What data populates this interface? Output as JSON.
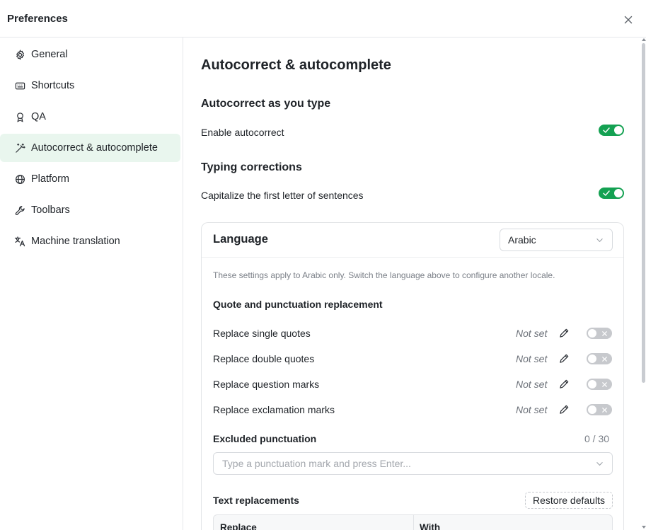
{
  "dialog": {
    "title": "Preferences",
    "close_icon": "close-icon"
  },
  "sidebar": {
    "items": [
      {
        "label": "General",
        "icon": "gear-icon",
        "active": false
      },
      {
        "label": "Shortcuts",
        "icon": "keyboard-icon",
        "active": false
      },
      {
        "label": "QA",
        "icon": "award-icon",
        "active": false
      },
      {
        "label": "Autocorrect & autocomplete",
        "icon": "magic-wand-icon",
        "active": true
      },
      {
        "label": "Platform",
        "icon": "globe-icon",
        "active": false
      },
      {
        "label": "Toolbars",
        "icon": "wrench-icon",
        "active": false
      },
      {
        "label": "Machine translation",
        "icon": "translate-icon",
        "active": false
      }
    ]
  },
  "colors": {
    "accent_green": "#14a152",
    "active_nav_bg": "#e9f6ee",
    "toggle_off": "#c7c9cd"
  },
  "main": {
    "page_title": "Autocorrect & autocomplete",
    "section_autocorrect": {
      "heading": "Autocorrect as you type",
      "enable_label": "Enable autocorrect",
      "enable_on": true
    },
    "section_typing": {
      "heading": "Typing corrections",
      "capitalize_label": "Capitalize the first letter of sentences",
      "capitalize_on": true
    },
    "language": {
      "heading": "Language",
      "selected": "Arabic",
      "note": "These settings apply to Arabic only. Switch the language above to configure another locale.",
      "quote_heading": "Quote and punctuation replacement",
      "replacements": [
        {
          "label": "Replace single quotes",
          "value": "Not set",
          "on": false
        },
        {
          "label": "Replace double quotes",
          "value": "Not set",
          "on": false
        },
        {
          "label": "Replace question marks",
          "value": "Not set",
          "on": false
        },
        {
          "label": "Replace exclamation marks",
          "value": "Not set",
          "on": false
        }
      ],
      "excluded": {
        "heading": "Excluded punctuation",
        "count": "0 / 30",
        "placeholder": "Type a punctuation mark and press Enter..."
      },
      "text_replacements": {
        "heading": "Text replacements",
        "restore_label": "Restore defaults",
        "columns": [
          "Replace",
          "With"
        ]
      }
    }
  }
}
